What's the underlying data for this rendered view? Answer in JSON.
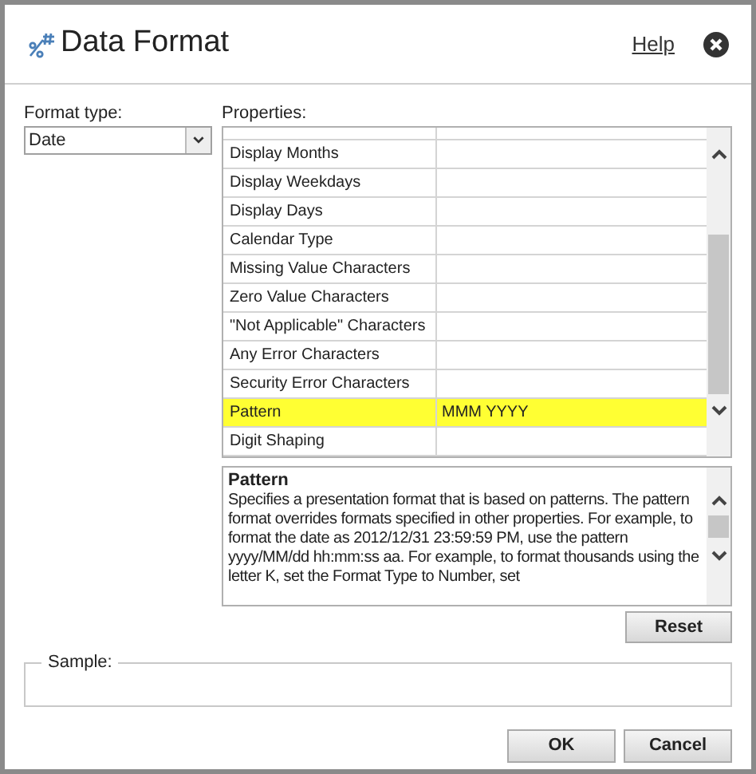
{
  "window": {
    "title": "Data Format",
    "help": "Help"
  },
  "format_type": {
    "label": "Format type:",
    "value": "Date"
  },
  "properties": {
    "label": "Properties:",
    "rows": [
      {
        "name": "Display Months",
        "value": "",
        "selected": false
      },
      {
        "name": "Display Weekdays",
        "value": "",
        "selected": false
      },
      {
        "name": "Display Days",
        "value": "",
        "selected": false
      },
      {
        "name": "Calendar Type",
        "value": "",
        "selected": false
      },
      {
        "name": "Missing Value Characters",
        "value": "",
        "selected": false
      },
      {
        "name": "Zero Value Characters",
        "value": "",
        "selected": false
      },
      {
        "name": "\"Not Applicable\" Characters",
        "value": "",
        "selected": false
      },
      {
        "name": "Any Error Characters",
        "value": "",
        "selected": false
      },
      {
        "name": "Security Error Characters",
        "value": "",
        "selected": false
      },
      {
        "name": "Pattern",
        "value": "MMM YYYY",
        "selected": true
      },
      {
        "name": "Digit Shaping",
        "value": "",
        "selected": false
      }
    ]
  },
  "description": {
    "title": "Pattern",
    "text": "Specifies a presentation format that is based on patterns. The pattern format overrides formats specified in other properties. For example, to format the date as 2012/12/31 23:59:59 PM, use the pattern yyyy/MM/dd hh:mm:ss aa. For example, to format thousands using the letter K, set the Format Type to Number, set"
  },
  "reset_button": "Reset",
  "sample": {
    "label": "Sample:"
  },
  "buttons": [
    "OK",
    "Cancel"
  ]
}
